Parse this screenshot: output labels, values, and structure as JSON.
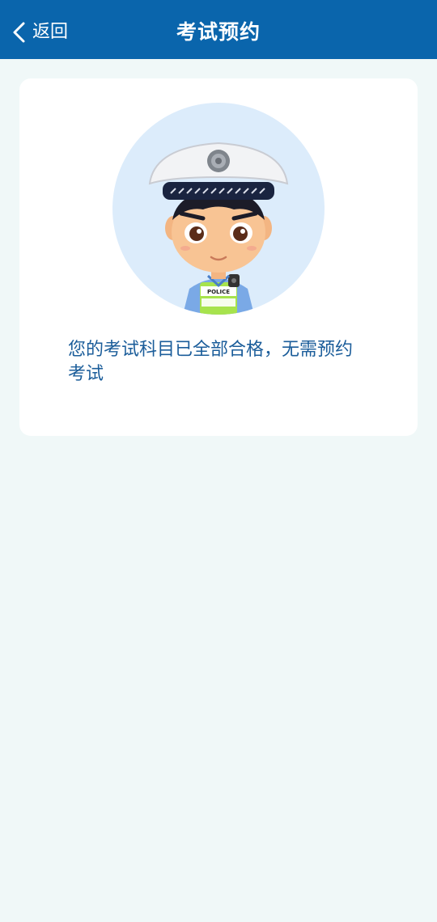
{
  "header": {
    "back_label": "返回",
    "title": "考试预约"
  },
  "card": {
    "message": "您的考试科目已全部合格，无需预约考试",
    "illustration": {
      "badge_text": "POLICE"
    }
  },
  "colors": {
    "header_bg": "#0a65ac",
    "page_bg": "#f0f8f8",
    "card_bg": "#ffffff",
    "avatar_bg": "#dcecfb",
    "message_text": "#1b5d9a"
  },
  "icons": {
    "back": "chevron-left-icon",
    "avatar": "police-officer-avatar"
  }
}
